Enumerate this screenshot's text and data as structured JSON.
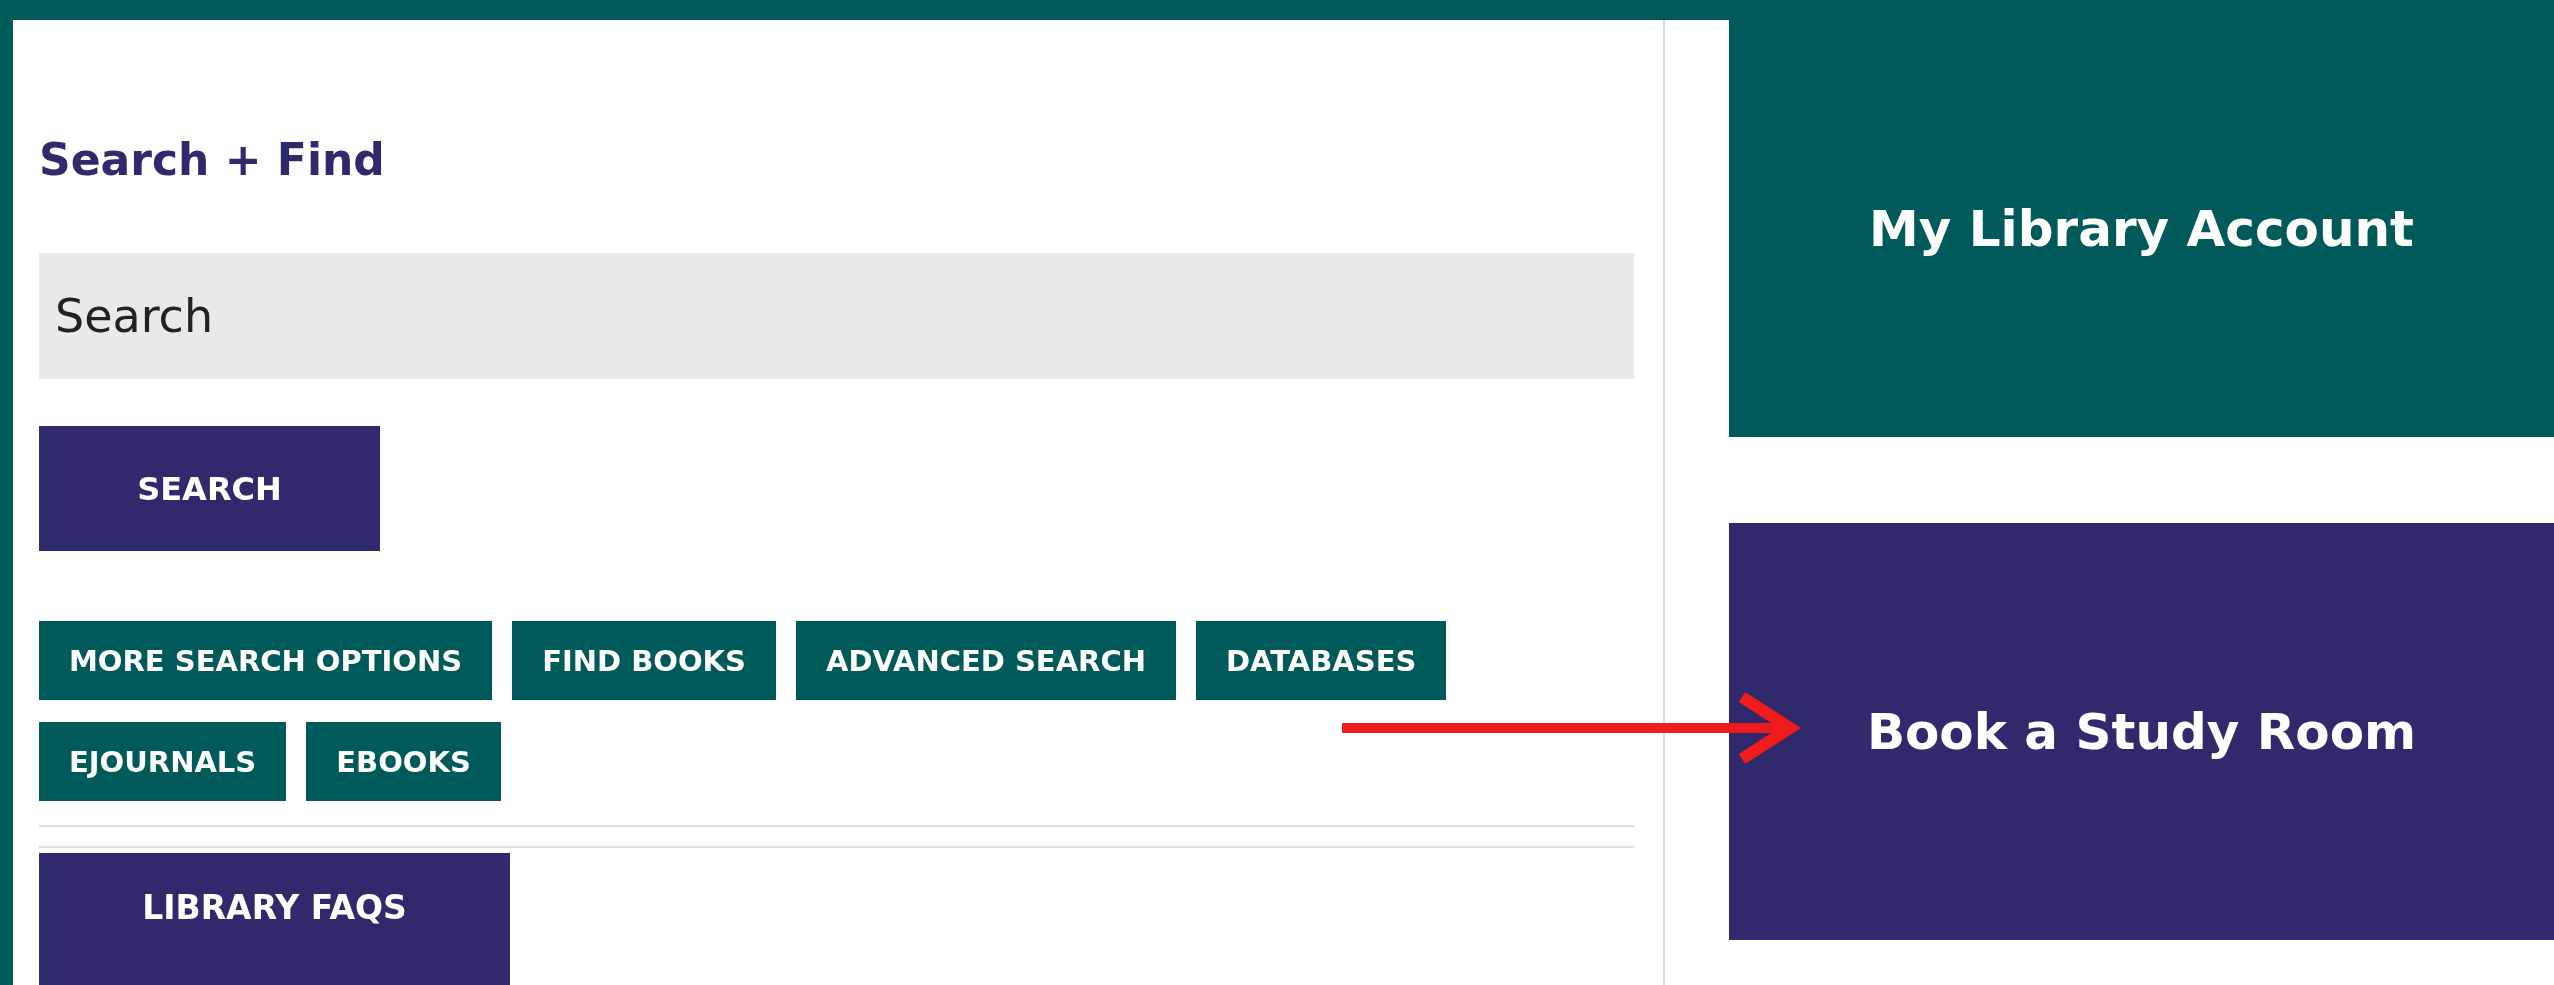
{
  "search_panel": {
    "heading": "Search + Find",
    "search_field": {
      "placeholder": "Search"
    },
    "search_button": "SEARCH",
    "quick_links": [
      "MORE SEARCH OPTIONS",
      "FIND BOOKS",
      "ADVANCED SEARCH",
      "DATABASES",
      "EJOURNALS",
      "EBOOKS"
    ],
    "faq_button": "LIBRARY FAQS"
  },
  "tiles": [
    {
      "label": "My Library Account",
      "color": "#005a5a"
    },
    {
      "label": "Book a Study Room",
      "color": "#2e2a6b"
    }
  ]
}
